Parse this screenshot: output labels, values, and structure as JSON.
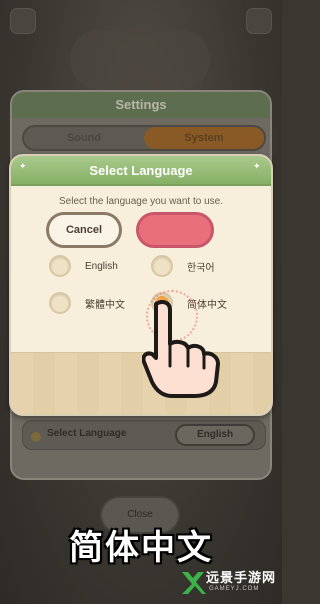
{
  "settings": {
    "title": "Settings",
    "tabs": [
      {
        "label": "Sound",
        "active": false
      },
      {
        "label": "System",
        "active": true
      }
    ],
    "language_row": {
      "label": "Select Language",
      "value": "English"
    },
    "close_label": "Close"
  },
  "dialog": {
    "title": "Select Language",
    "subtitle": "Select the language you want to use.",
    "options": [
      {
        "label": "English",
        "selected": false
      },
      {
        "label": "한국어",
        "selected": false
      },
      {
        "label": "繁體中文",
        "selected": false
      },
      {
        "label": "简体中文",
        "selected": true
      }
    ],
    "cancel_label": "Cancel",
    "ok_label": ""
  },
  "caption": "简体中文",
  "watermark": {
    "text": "远景手游网",
    "url": "GAMEYJ.COM"
  },
  "colors": {
    "header_green": "#86b066",
    "dialog_bg": "#f7efdc",
    "ok_pink": "#e9707b",
    "selected_orange": "#f0a64a",
    "watermark_green": "#3bb24a"
  }
}
